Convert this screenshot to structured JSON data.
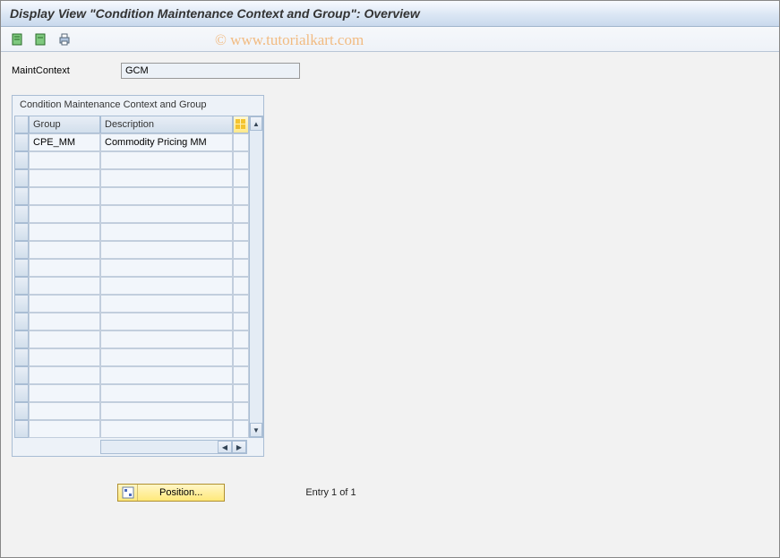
{
  "header": {
    "title": "Display View \"Condition Maintenance Context and Group\": Overview"
  },
  "toolbar": {
    "icons": [
      "expand-icon",
      "collapse-icon",
      "print-icon"
    ]
  },
  "fields": {
    "maint_context_label": "MaintContext",
    "maint_context_value": "GCM"
  },
  "groupbox": {
    "title": "Condition Maintenance Context and Group",
    "columns": {
      "group": "Group",
      "description": "Description"
    },
    "rows": [
      {
        "group": "CPE_MM",
        "description": "Commodity Pricing MM"
      },
      {
        "group": "",
        "description": ""
      },
      {
        "group": "",
        "description": ""
      },
      {
        "group": "",
        "description": ""
      },
      {
        "group": "",
        "description": ""
      },
      {
        "group": "",
        "description": ""
      },
      {
        "group": "",
        "description": ""
      },
      {
        "group": "",
        "description": ""
      },
      {
        "group": "",
        "description": ""
      },
      {
        "group": "",
        "description": ""
      },
      {
        "group": "",
        "description": ""
      },
      {
        "group": "",
        "description": ""
      },
      {
        "group": "",
        "description": ""
      },
      {
        "group": "",
        "description": ""
      },
      {
        "group": "",
        "description": ""
      },
      {
        "group": "",
        "description": ""
      },
      {
        "group": "",
        "description": ""
      }
    ]
  },
  "footer": {
    "position_label": "Position...",
    "entry_text": "Entry 1 of 1"
  },
  "watermark": "© www.tutorialkart.com"
}
